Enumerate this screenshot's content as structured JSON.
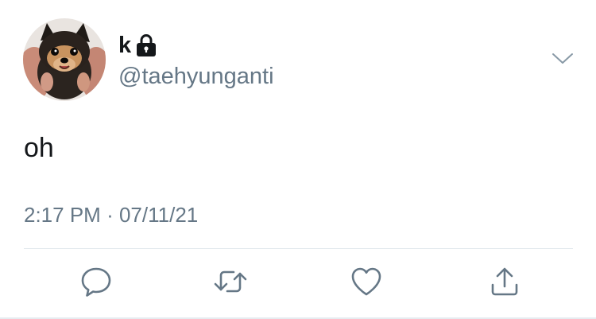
{
  "tweet": {
    "author": {
      "display_name": "k",
      "handle": "@taehyunganti",
      "protected_icon": "lock-icon",
      "avatar": "pomeranian-dog-photo"
    },
    "text": "oh",
    "time": "2:17 PM",
    "separator": "·",
    "date": "07/11/21",
    "menu_icon": "chevron-down-icon",
    "actions": [
      {
        "name": "reply",
        "icon": "speech-bubble-icon"
      },
      {
        "name": "retweet",
        "icon": "retweet-icon"
      },
      {
        "name": "like",
        "icon": "heart-icon"
      },
      {
        "name": "share",
        "icon": "share-icon"
      }
    ]
  },
  "colors": {
    "text_primary": "#14171a",
    "text_secondary": "#657786",
    "icon": "#657786",
    "divider": "#e1e8ed"
  }
}
